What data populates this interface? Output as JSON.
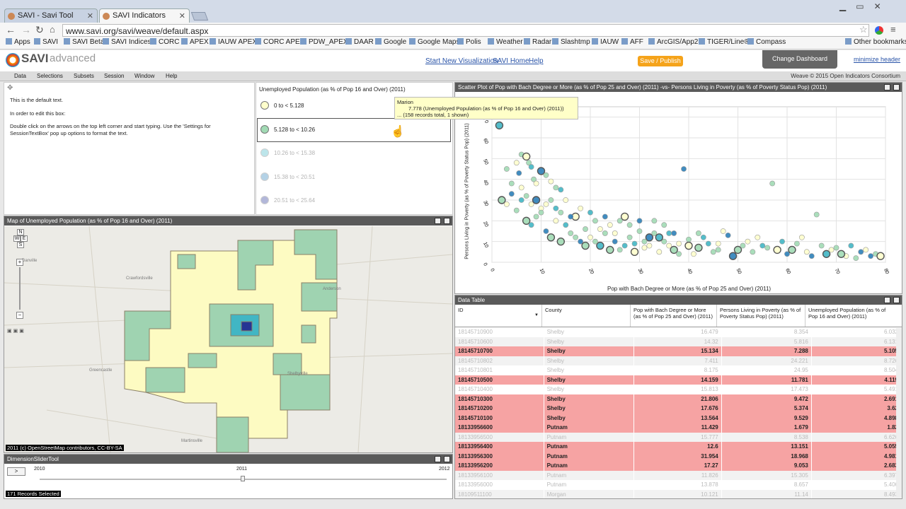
{
  "browser": {
    "tabs": [
      {
        "label": "SAVI - Savi Tool"
      },
      {
        "label": "SAVI Indicators"
      }
    ],
    "url": "www.savi.org/savi/weave/default.aspx",
    "bookmarks": [
      "Apps",
      "SAVI",
      "SAVI Beta",
      "SAVI Indices",
      "CORC",
      "APEX",
      "IAUW APEX",
      "CORC APEX",
      "PDW_APEX",
      "DAAR",
      "Google",
      "Google Maps",
      "Polis",
      "Weather",
      "Radar",
      "Slashtmp",
      "IAUW",
      "AFF",
      "ArcGIS/App25",
      "TIGER/Line®",
      "Compass"
    ],
    "other_bookmarks": "Other bookmarks"
  },
  "header": {
    "logo_savi": "SAVI",
    "logo_adv": "advanced",
    "links": [
      "Start New Visualization",
      "SAVI Home",
      "Help"
    ],
    "publish": "Save / Publish",
    "change_dashboard": "Change Dashboard",
    "minimize": "minimize header",
    "credit": "Weave © 2015 Open Indicators Consortium"
  },
  "menus": [
    "Data",
    "Selections",
    "Subsets",
    "Session",
    "Window",
    "Help"
  ],
  "textbox": {
    "lines": [
      "This is the default text.",
      "In order to edit this box:",
      "Double click on the arrows on the top left corner and start typing. Use the 'Settings for SessionTextBox' pop up options to format the text."
    ]
  },
  "legend": {
    "title": "Unemployed Population (as % of Pop 16 and Over) (2011)",
    "items": [
      {
        "label": "0 to < 5.128",
        "color": "#ffffcc"
      },
      {
        "label": "5.128 to < 10.26",
        "color": "#a1dab4"
      },
      {
        "label": "10.26 to < 15.38",
        "color": "#41b6c4"
      },
      {
        "label": "15.38 to < 20.51",
        "color": "#2c7fb8"
      },
      {
        "label": "20.51 to < 25.64",
        "color": "#253494"
      }
    ]
  },
  "tooltip": {
    "name": "Marion",
    "value": "7.778 (Unemployed Population (as % of Pop 16 and Over) (2011))",
    "records": "... (158 records total, 1 shown)"
  },
  "map": {
    "title": "Map of Unemployed Population (as % of Pop 16 and Over) (2011)",
    "attribution": "2011 (c) OpenStreetMap contributors, CC-BY-SA",
    "compass": [
      "N",
      "W",
      "E",
      "S"
    ]
  },
  "slider": {
    "title": "DimensionSliderTool",
    "play": ">",
    "years": [
      "2010",
      "2011",
      "2012"
    ],
    "status": "171 Records Selected"
  },
  "chart_data": {
    "type": "scatter",
    "title": "Scatter Plot of Pop with Bach Degree or More (as % of Pop 25 and Over) (2011) -vs- Persons Living in Poverty (as % of Poverty Status Pop) (2011)",
    "xlabel": "Pop with Bach Degree or More (as % of Pop 25 and Over) (2011)",
    "ylabel": "Persons Living in Poverty (as % of Poverty Status Pop) (2011)",
    "xlim": [
      0,
      80
    ],
    "ylim": [
      0,
      75
    ],
    "xticks": [
      "0",
      "10",
      "20",
      "30",
      "40",
      "50",
      "60",
      "70",
      "80"
    ],
    "yticks": [
      "0",
      "10",
      "20",
      "30",
      "40",
      "50",
      "60",
      "70"
    ],
    "points": [
      [
        1.5,
        66
      ],
      [
        3,
        45
      ],
      [
        5,
        48
      ],
      [
        5.5,
        43
      ],
      [
        6,
        52
      ],
      [
        7,
        51
      ],
      [
        7.5,
        48
      ],
      [
        8,
        46
      ],
      [
        8.5,
        40
      ],
      [
        9,
        38
      ],
      [
        10,
        44
      ],
      [
        11,
        42
      ],
      [
        12,
        39
      ],
      [
        13,
        36
      ],
      [
        14,
        35
      ],
      [
        2,
        30
      ],
      [
        3,
        28
      ],
      [
        4,
        33
      ],
      [
        5,
        25
      ],
      [
        6,
        36
      ],
      [
        7,
        20
      ],
      [
        8,
        18
      ],
      [
        9,
        22
      ],
      [
        10,
        26
      ],
      [
        11,
        15
      ],
      [
        12,
        12
      ],
      [
        13,
        20
      ],
      [
        14,
        24
      ],
      [
        15,
        18
      ],
      [
        16,
        14
      ],
      [
        17,
        22
      ],
      [
        18,
        10
      ],
      [
        19,
        16
      ],
      [
        20,
        12
      ],
      [
        21,
        20
      ],
      [
        22,
        8
      ],
      [
        23,
        14
      ],
      [
        24,
        18
      ],
      [
        25,
        10
      ],
      [
        26,
        6
      ],
      [
        27,
        22
      ],
      [
        28,
        12
      ],
      [
        29,
        9
      ],
      [
        30,
        15
      ],
      [
        31,
        7
      ],
      [
        32,
        12
      ],
      [
        33,
        20
      ],
      [
        34,
        5
      ],
      [
        35,
        10
      ],
      [
        36,
        14
      ],
      [
        37,
        6
      ],
      [
        38,
        9
      ],
      [
        39,
        45
      ],
      [
        40,
        11
      ],
      [
        41,
        4
      ],
      [
        42,
        7
      ],
      [
        43,
        12
      ],
      [
        45,
        5
      ],
      [
        46,
        9
      ],
      [
        48,
        13
      ],
      [
        50,
        6
      ],
      [
        52,
        10
      ],
      [
        53,
        5
      ],
      [
        55,
        8
      ],
      [
        57,
        38
      ],
      [
        58,
        6
      ],
      [
        60,
        4
      ],
      [
        62,
        9
      ],
      [
        64,
        5
      ],
      [
        66,
        23
      ],
      [
        68,
        4
      ],
      [
        70,
        7
      ],
      [
        72,
        3
      ],
      [
        75,
        5
      ],
      [
        78,
        4
      ],
      [
        79,
        3
      ],
      [
        4,
        38
      ],
      [
        6,
        30
      ],
      [
        7,
        32
      ],
      [
        8,
        28
      ],
      [
        9,
        30
      ],
      [
        10,
        24
      ],
      [
        11,
        28
      ],
      [
        12,
        30
      ],
      [
        13,
        26
      ],
      [
        14,
        10
      ],
      [
        15,
        30
      ],
      [
        16,
        22
      ],
      [
        17,
        12
      ],
      [
        18,
        26
      ],
      [
        19,
        8
      ],
      [
        20,
        24
      ],
      [
        21,
        10
      ],
      [
        22,
        16
      ],
      [
        23,
        22
      ],
      [
        24,
        6
      ],
      [
        25,
        14
      ],
      [
        26,
        20
      ],
      [
        27,
        8
      ],
      [
        28,
        18
      ],
      [
        29,
        5
      ],
      [
        30,
        20
      ],
      [
        31,
        10
      ],
      [
        32,
        8
      ],
      [
        33,
        14
      ],
      [
        34,
        12
      ],
      [
        35,
        18
      ],
      [
        36,
        8
      ],
      [
        37,
        14
      ],
      [
        38,
        4
      ],
      [
        40,
        8
      ],
      [
        42,
        14
      ],
      [
        44,
        9
      ],
      [
        46,
        6
      ],
      [
        47,
        15
      ],
      [
        49,
        3
      ],
      [
        51,
        8
      ],
      [
        54,
        12
      ],
      [
        56,
        7
      ],
      [
        59,
        10
      ],
      [
        61,
        6
      ],
      [
        63,
        12
      ],
      [
        65,
        3
      ],
      [
        67,
        8
      ],
      [
        69,
        6
      ],
      [
        71,
        4
      ],
      [
        73,
        8
      ],
      [
        74,
        2
      ],
      [
        76,
        6
      ],
      [
        77,
        3
      ]
    ],
    "point_colors": [
      "#41b6c4",
      "#a1dab4",
      "#ffffcc",
      "#2c7fb8",
      "#a1dab4",
      "#ffffcc",
      "#a1dab4"
    ]
  },
  "table": {
    "title": "Data Table",
    "columns": [
      "ID",
      "County",
      "Pop with Bach Degree or More (as % of Pop 25 and Over) (2011)",
      "Persons Living in Poverty (as % of Poverty Status Pop) (2011)",
      "Unemployed Population (as % of Pop 16 and Over) (2011)"
    ],
    "rows": [
      {
        "id": "18145710900",
        "county": "Shelby",
        "a": "16.479",
        "b": "8.354",
        "c": "6.032",
        "sel": false
      },
      {
        "id": "18145710600",
        "county": "Shelby",
        "a": "14.32",
        "b": "5.816",
        "c": "6.131",
        "sel": false
      },
      {
        "id": "18145710700",
        "county": "Shelby",
        "a": "15.134",
        "b": "7.288",
        "c": "5.105",
        "sel": true
      },
      {
        "id": "18145710802",
        "county": "Shelby",
        "a": "7.411",
        "b": "24.221",
        "c": "8.726",
        "sel": false
      },
      {
        "id": "18145710801",
        "county": "Shelby",
        "a": "8.175",
        "b": "24.95",
        "c": "8.504",
        "sel": false
      },
      {
        "id": "18145710500",
        "county": "Shelby",
        "a": "14.159",
        "b": "11.781",
        "c": "4.119",
        "sel": true
      },
      {
        "id": "18145710400",
        "county": "Shelby",
        "a": "15.813",
        "b": "17.473",
        "c": "5.491",
        "sel": false
      },
      {
        "id": "18145710300",
        "county": "Shelby",
        "a": "21.806",
        "b": "9.472",
        "c": "2.691",
        "sel": true
      },
      {
        "id": "18145710200",
        "county": "Shelby",
        "a": "17.676",
        "b": "5.374",
        "c": "3.62",
        "sel": true
      },
      {
        "id": "18145710100",
        "county": "Shelby",
        "a": "13.564",
        "b": "9.529",
        "c": "4.898",
        "sel": true
      },
      {
        "id": "18133956600",
        "county": "Putnam",
        "a": "11.429",
        "b": "1.679",
        "c": "1.82",
        "sel": true
      },
      {
        "id": "18133956500",
        "county": "Putnam",
        "a": "15.777",
        "b": "8.538",
        "c": "6.626",
        "sel": false
      },
      {
        "id": "18133956400",
        "county": "Putnam",
        "a": "12.6",
        "b": "13.151",
        "c": "5.055",
        "sel": true
      },
      {
        "id": "18133956300",
        "county": "Putnam",
        "a": "31.954",
        "b": "18.968",
        "c": "4.981",
        "sel": true
      },
      {
        "id": "18133956200",
        "county": "Putnam",
        "a": "17.27",
        "b": "9.053",
        "c": "2.683",
        "sel": true
      },
      {
        "id": "18133956100",
        "county": "Putnam",
        "a": "11.826",
        "b": "15.305",
        "c": "6.397",
        "sel": false
      },
      {
        "id": "18133956000",
        "county": "Putnam",
        "a": "13.878",
        "b": "8.657",
        "c": "5.406",
        "sel": false
      },
      {
        "id": "18109511100",
        "county": "Morgan",
        "a": "10.121",
        "b": "11.14",
        "c": "8.493",
        "sel": false
      }
    ]
  }
}
